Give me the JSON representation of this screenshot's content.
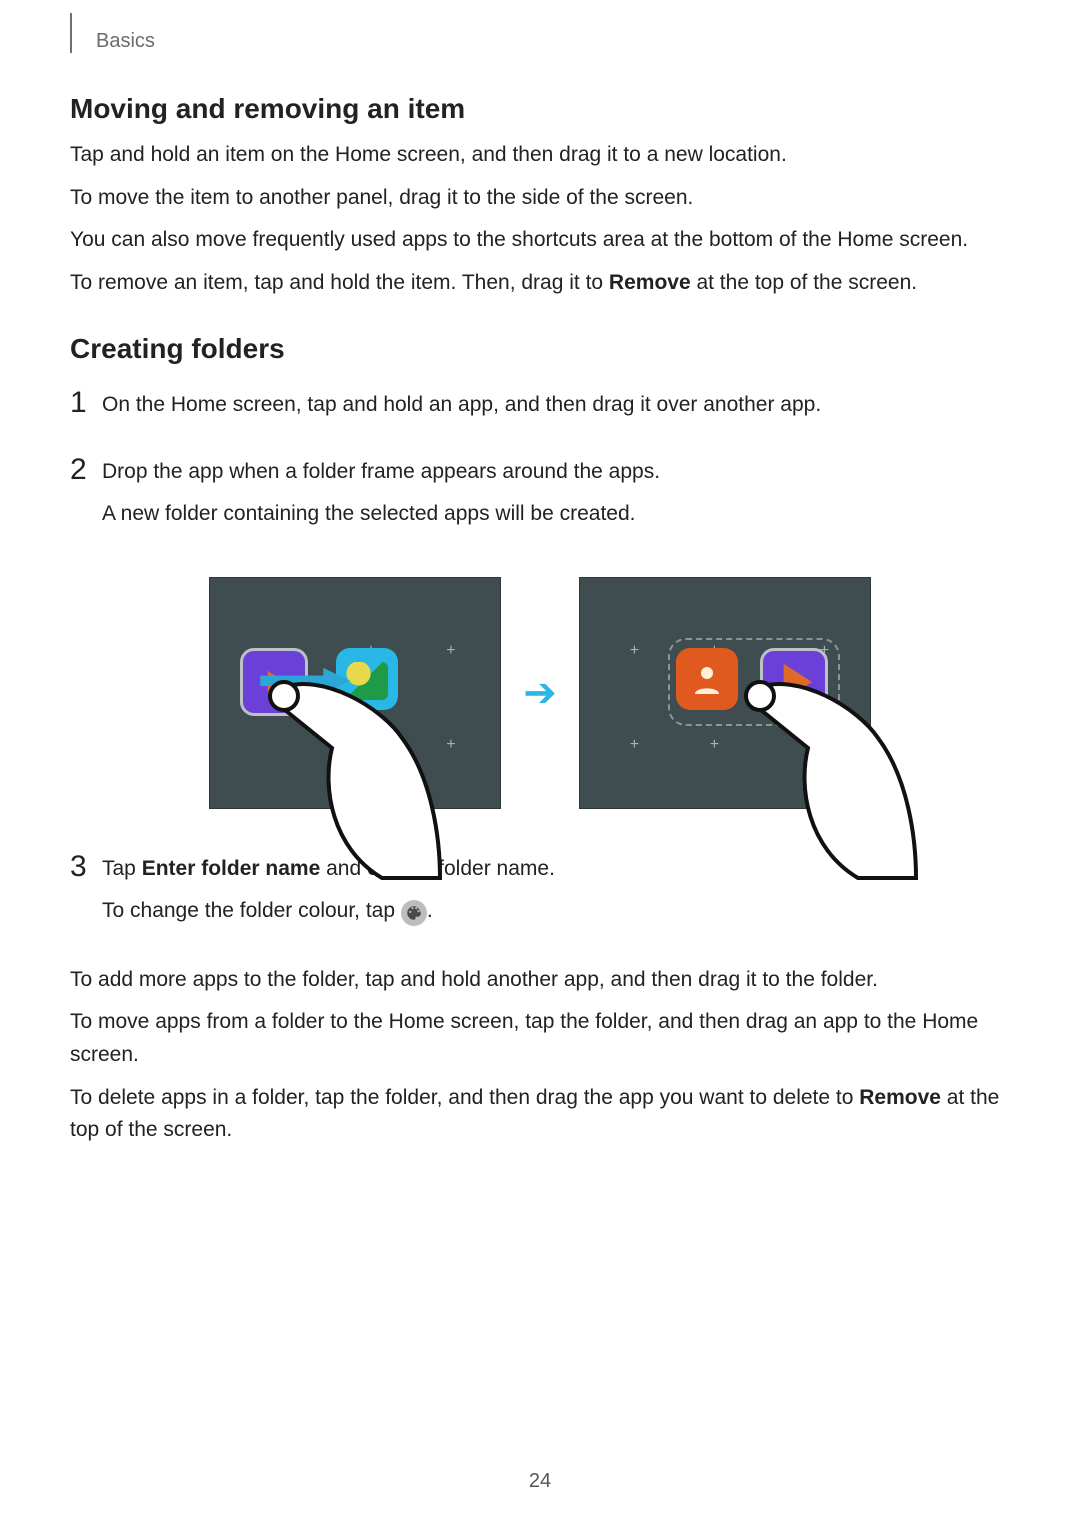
{
  "breadcrumb": "Basics",
  "section1": {
    "heading": "Moving and removing an item",
    "p1": "Tap and hold an item on the Home screen, and then drag it to a new location.",
    "p2": "To move the item to another panel, drag it to the side of the screen.",
    "p3": "You can also move frequently used apps to the shortcuts area at the bottom of the Home screen.",
    "p4a": "To remove an item, tap and hold the item. Then, drag it to ",
    "p4b": "Remove",
    "p4c": " at the top of the screen."
  },
  "section2": {
    "heading": "Creating folders",
    "step1": {
      "num": "1",
      "text": "On the Home screen, tap and hold an app, and then drag it over another app."
    },
    "step2": {
      "num": "2",
      "line1": "Drop the app when a folder frame appears around the apps.",
      "line2": "A new folder containing the selected apps will be created."
    },
    "step3": {
      "num": "3",
      "l1a": "Tap ",
      "l1b": "Enter folder name",
      "l1c": " and enter a folder name.",
      "l2": "To change the folder colour, tap "
    },
    "p_after1": "To add more apps to the folder, tap and hold another app, and then drag it to the folder.",
    "p_after2": "To move apps from a folder to the Home screen, tap the folder, and then drag an app to the Home screen.",
    "p_after3a": "To delete apps in a folder, tap the folder, and then drag the app you want to delete to ",
    "p_after3b": "Remove",
    "p_after3c": " at the top of the screen."
  },
  "pageNumber": "24"
}
